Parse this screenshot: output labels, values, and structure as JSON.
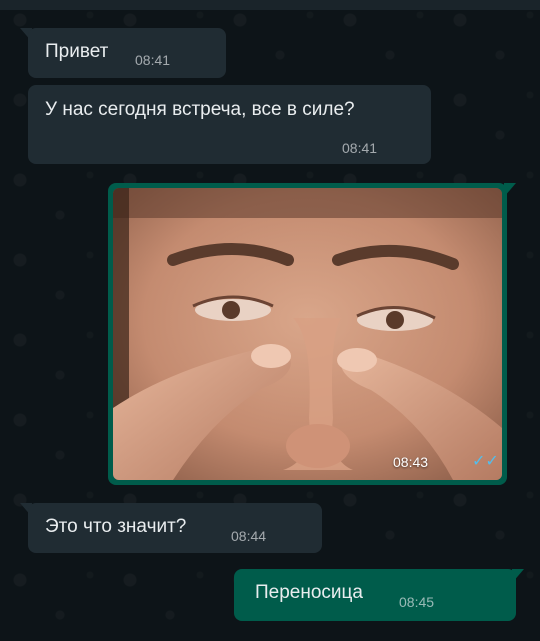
{
  "messages": [
    {
      "direction": "incoming",
      "text": "Привет",
      "time": "08:41"
    },
    {
      "direction": "incoming",
      "text": "У нас сегодня встреча, все в силе?",
      "time": "08:41"
    },
    {
      "direction": "outgoing",
      "type": "image",
      "time": "08:43",
      "status": "read-checkmarks-icon"
    },
    {
      "direction": "incoming",
      "text": "Это что значит?",
      "time": "08:44"
    },
    {
      "direction": "outgoing",
      "text": "Переносица",
      "time": "08:45"
    }
  ],
  "colors": {
    "incoming_bubble": "#202c33",
    "outgoing_bubble": "#005c4b",
    "background": "#0b141a",
    "read_ticks": "#53bdeb"
  }
}
